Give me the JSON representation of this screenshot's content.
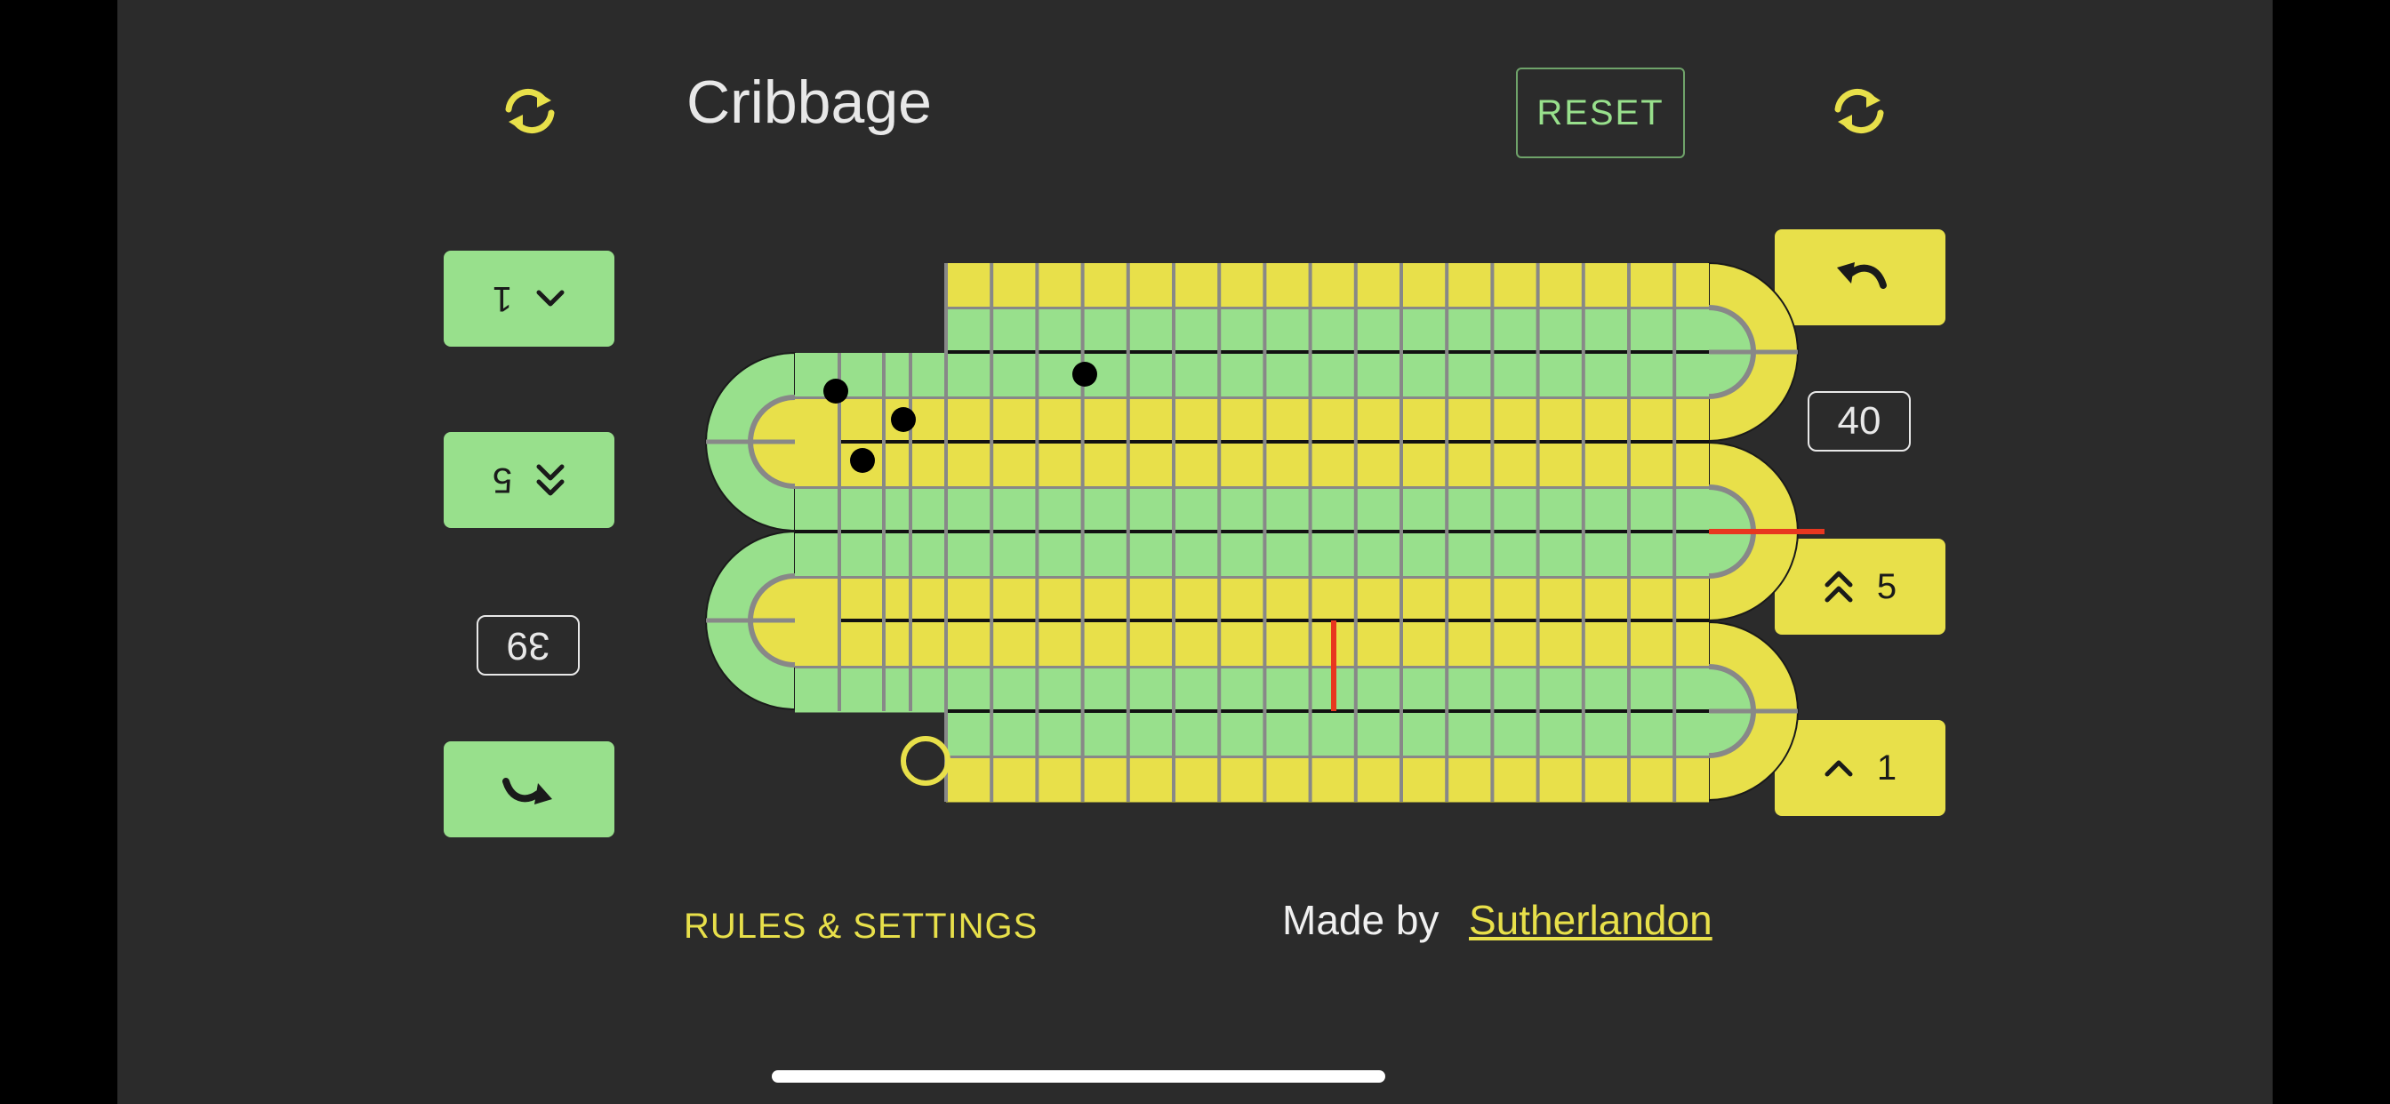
{
  "app": {
    "title": "Cribbage"
  },
  "header": {
    "reset_label": "RESET"
  },
  "left_player": {
    "plus_one_label": "1",
    "plus_five_label": "5",
    "score": "39",
    "color": "#98e08c"
  },
  "right_player": {
    "plus_one_label": "1",
    "plus_five_label": "5",
    "score": "40",
    "color": "#e8e04a"
  },
  "footer": {
    "rules_label": "RULES & SETTINGS",
    "made_by_label": "Made by",
    "author_link": "Sutherlandon"
  },
  "icons": {
    "swap": "swap-arrows-icon",
    "undo": "undo-icon",
    "plus_one": "chevron-up-icon",
    "plus_five": "double-chevron-up-icon"
  },
  "colors": {
    "background": "#2b2b2b",
    "green": "#98e08c",
    "yellow": "#e8e04a",
    "marker": "#e8371f"
  }
}
